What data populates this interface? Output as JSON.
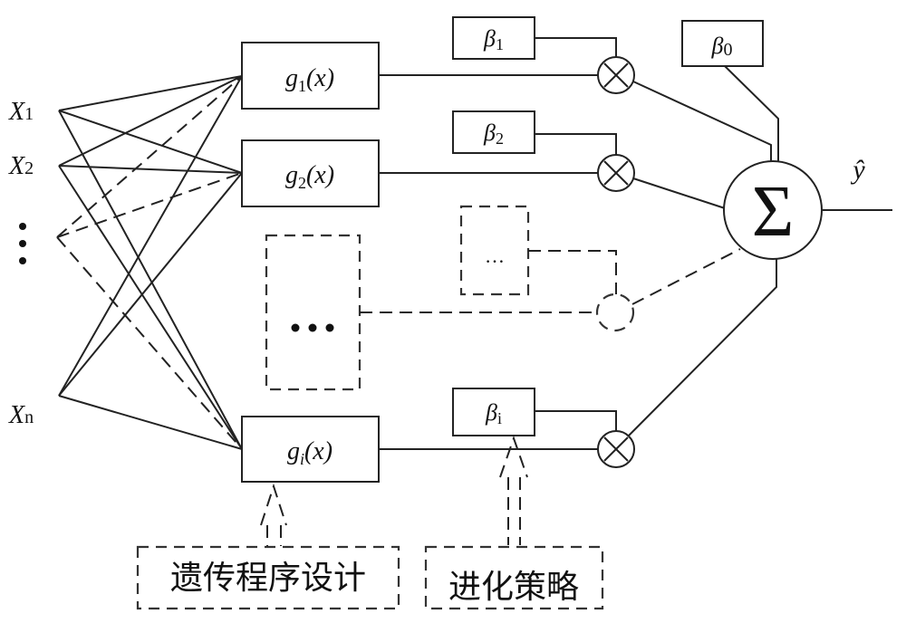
{
  "diagram": {
    "inputs": [
      {
        "label": "X",
        "sub": "1"
      },
      {
        "label": "X",
        "sub": "2"
      },
      {
        "label": "⋮",
        "sub": ""
      },
      {
        "label": "X",
        "sub": "n"
      }
    ],
    "functions": [
      {
        "name": "g",
        "sub": "1",
        "arg": "(x)"
      },
      {
        "name": "g",
        "sub": "2",
        "arg": "(x)"
      },
      {
        "name": "…",
        "sub": "",
        "arg": ""
      },
      {
        "name": "g",
        "sub": "i",
        "arg": "(x)"
      }
    ],
    "weights": [
      {
        "name": "β",
        "sub": "1"
      },
      {
        "name": "β",
        "sub": "2"
      },
      {
        "name": "…",
        "sub": ""
      },
      {
        "name": "β",
        "sub": "i"
      }
    ],
    "bias": {
      "name": "β",
      "sub": "0"
    },
    "sum_symbol": "Σ",
    "multiply_symbol": "×",
    "output": {
      "label": "ŷ"
    },
    "methods": {
      "genetic_programming": "遗传程序设计",
      "evolution_strategy": "进化策略"
    }
  }
}
